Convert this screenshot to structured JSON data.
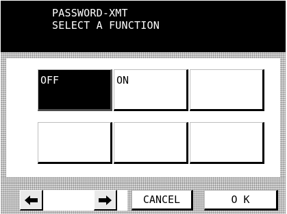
{
  "header": {
    "line1": "PASSWORD-XMT",
    "line2": "SELECT A FUNCTION"
  },
  "buttons": [
    {
      "label": "OFF",
      "selected": true
    },
    {
      "label": "ON",
      "selected": false
    },
    {
      "label": "",
      "selected": false
    },
    {
      "label": "",
      "selected": false
    },
    {
      "label": "",
      "selected": false
    },
    {
      "label": "",
      "selected": false
    }
  ],
  "footer": {
    "back_icon": "arrow-left-icon",
    "forward_icon": "arrow-right-icon",
    "cancel_label": "CANCEL",
    "ok_label": "O K"
  },
  "colors": {
    "header_bg": "#000000",
    "header_text": "#ffffff",
    "selected_bg": "#000000",
    "selected_text": "#ffffff",
    "frame_pattern": "#d7d7d7"
  }
}
